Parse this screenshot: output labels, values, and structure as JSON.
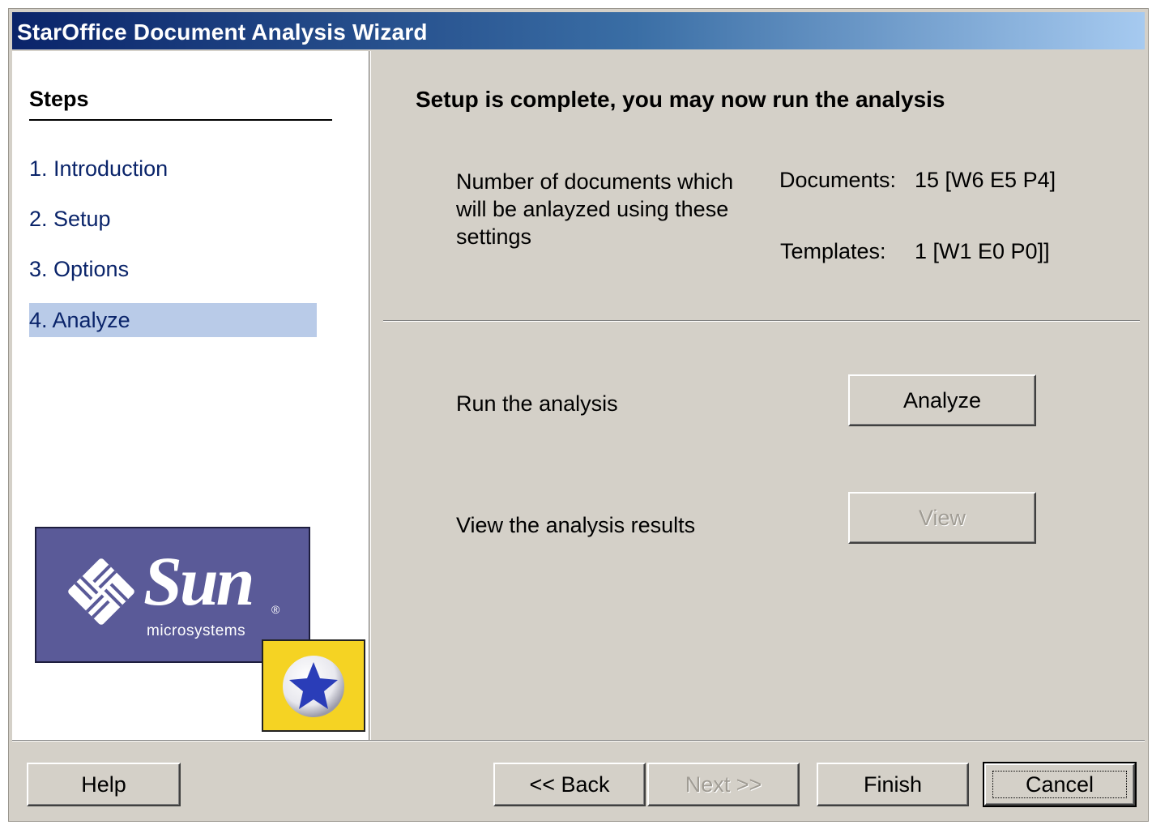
{
  "window": {
    "title": "StarOffice Document Analysis Wizard"
  },
  "sidebar": {
    "heading": "Steps",
    "items": [
      {
        "label": "1. Introduction",
        "active": false
      },
      {
        "label": "2. Setup",
        "active": false
      },
      {
        "label": "3. Options",
        "active": false
      },
      {
        "label": "4. Analyze",
        "active": true
      }
    ],
    "logo": {
      "wordmark": "Sun",
      "subtext": "microsystems",
      "registered": "®"
    }
  },
  "main": {
    "heading": "Setup is complete, you may now run the analysis",
    "count_description": "Number of documents which will be anlayzed using these settings",
    "documents_label": "Documents:",
    "documents_value": "15 [W6 E5 P4]",
    "templates_label": "Templates:",
    "templates_value": "1 [W1 E0 P0]]",
    "run_label": "Run the analysis",
    "analyze_button": "Analyze",
    "view_label": "View the analysis results",
    "view_button": "View"
  },
  "footer": {
    "help_button": "Help",
    "back_button": "<< Back",
    "next_button": "Next >>",
    "finish_button": "Finish",
    "cancel_button": "Cancel"
  },
  "colors": {
    "title_gradient_start": "#0a246a",
    "title_gradient_end": "#a6caf0",
    "face": "#d4d0c8",
    "active_step_bg": "#b9cbe8",
    "sun_purple": "#5a5a98",
    "staroffice_yellow": "#f5d323"
  }
}
